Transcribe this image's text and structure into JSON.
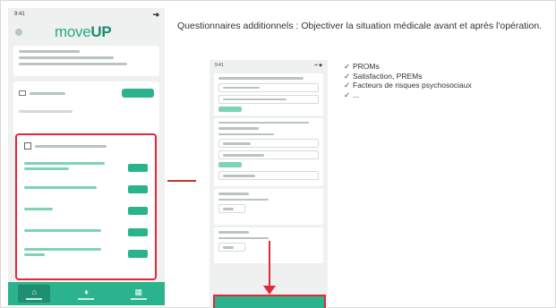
{
  "heading": "Questionnaires additionnels : Objectiver la situation médicale avant et après l'opération.",
  "bullets": [
    {
      "check": "✓",
      "text": "PROMs"
    },
    {
      "check": "✓",
      "text": "Satisfaction, PREMs"
    },
    {
      "check": "✓",
      "text": "Facteurs de risques psychosociaux"
    },
    {
      "check": "✓",
      "text": "..."
    }
  ],
  "phone_left": {
    "status_time": "9:41",
    "status_icons": "▪▪ ◆",
    "logo_light": "move",
    "logo_bold": "UP",
    "tab_icons": [
      "⌂",
      "♦",
      "▦"
    ]
  },
  "phone_right": {
    "status_time": "9:41",
    "status_icons": "▪▪ ◆"
  },
  "colors": {
    "brand_green": "#2bb38e",
    "highlight_red": "#e2283a",
    "connector_red": "#c0392b"
  }
}
